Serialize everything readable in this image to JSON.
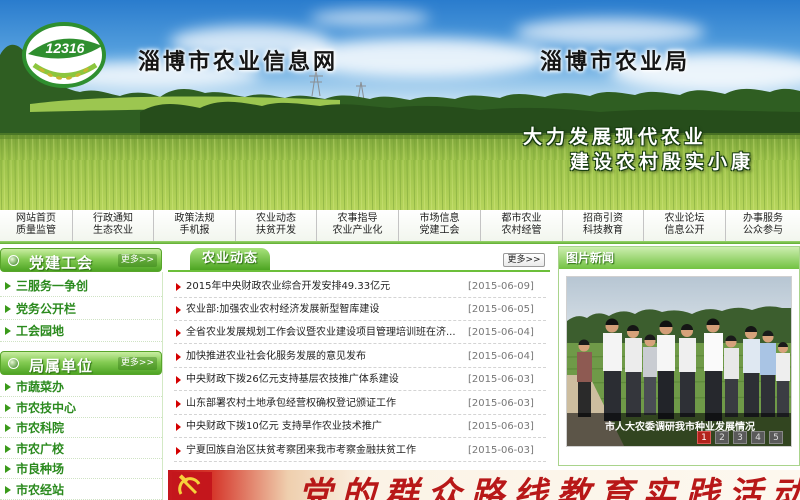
{
  "site": {
    "logo_text": "12316",
    "title": "淄博市农业信息网",
    "agency": "淄博市农业局",
    "slogan": [
      "大力发展现代农业",
      "建设农村殷实小康"
    ]
  },
  "nav": [
    {
      "top": "网站首页",
      "bottom": "质量监管"
    },
    {
      "top": "行政通知",
      "bottom": "生态农业"
    },
    {
      "top": "政策法规",
      "bottom": "手机报"
    },
    {
      "top": "农业动态",
      "bottom": "扶贫开发"
    },
    {
      "top": "农事指导",
      "bottom": "农业产业化"
    },
    {
      "top": "市场信息",
      "bottom": "党建工会"
    },
    {
      "top": "都市农业",
      "bottom": "农村经管"
    },
    {
      "top": "招商引资",
      "bottom": "科技教育"
    },
    {
      "top": "农业论坛",
      "bottom": "信息公开"
    },
    {
      "top": "办事服务",
      "bottom": "公众参与"
    }
  ],
  "sidebar": {
    "party_union": {
      "title": "党建工会",
      "more": "更多>>",
      "items": [
        "三服务一争创",
        "党务公开栏",
        "工会园地"
      ]
    },
    "units": {
      "title": "局属单位",
      "more": "更多>>",
      "items": [
        "市蔬菜办",
        "市农技中心",
        "市农科院",
        "市农广校",
        "市良种场",
        "市农经站"
      ]
    }
  },
  "news": {
    "title": "农业动态",
    "more": "更多>>",
    "items": [
      {
        "title": "2015年中央财政农业综合开发安排49.33亿元",
        "date": "[2015-06-09]"
      },
      {
        "title": "农业部:加强农业农村经济发展新型智库建设",
        "date": "[2015-06-05]"
      },
      {
        "title": "全省农业发展规划工作会议暨农业建设项目管理培训班在济...",
        "date": "[2015-06-04]"
      },
      {
        "title": "加快推进农业社会化服务发展的意见发布",
        "date": "[2015-06-04]"
      },
      {
        "title": "中央财政下拨26亿元支持基层农技推广体系建设",
        "date": "[2015-06-03]"
      },
      {
        "title": "山东部署农村土地承包经营权确权登记颁证工作",
        "date": "[2015-06-03]"
      },
      {
        "title": "中央财政下拨10亿元 支持旱作农业技术推广",
        "date": "[2015-06-03]"
      },
      {
        "title": "宁夏回族自治区扶贫考察团来我市考察金融扶贫工作",
        "date": "[2015-06-03]"
      }
    ]
  },
  "photo_news": {
    "title": "图片新闻",
    "caption": "市人大农委调研我市种业发展情况",
    "pages": [
      "1",
      "2",
      "3",
      "4",
      "5"
    ],
    "active_page": "1"
  },
  "banner": {
    "text": "党的群众路线教育实践活动"
  },
  "icons": {
    "logo": "agri-12316-logo",
    "section_marker": "section-marker-icon",
    "sidebar_bullet": "green-triangle-icon",
    "news_bullet": "red-triangle-icon",
    "banner_emblem": "party-emblem-icon"
  },
  "colors": {
    "accent_green": "#6cbf3a",
    "link_green": "#2b8a1e",
    "bullet_red": "#d40000",
    "banner_red": "#b81818",
    "active_page": "#b3231c"
  }
}
